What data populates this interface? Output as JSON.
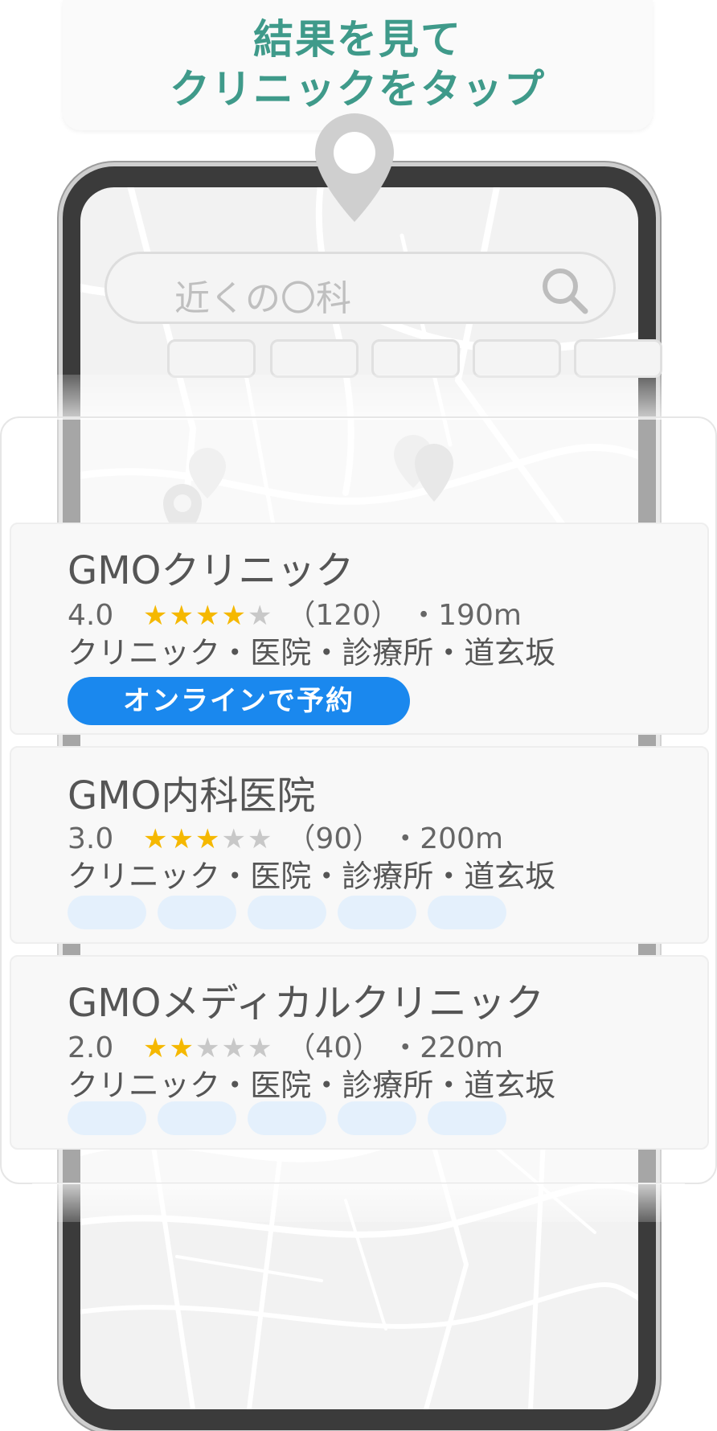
{
  "header": {
    "line1": "結果を見て",
    "line2": "クリニックをタップ"
  },
  "search": {
    "placeholder": "近くの〇科"
  },
  "clinics": [
    {
      "name": "GMOクリニック",
      "rating": "4.0",
      "stars": 4,
      "reviews": "（120）",
      "distance": "・190m",
      "category": "クリニック・医院・診療所・道玄坂",
      "booking_label": "オンラインで予約"
    },
    {
      "name": "GMO内科医院",
      "rating": "3.0",
      "stars": 3,
      "reviews": "（90）",
      "distance": "・200m",
      "category": "クリニック・医院・診療所・道玄坂"
    },
    {
      "name": "GMOメディカルクリニック",
      "rating": "2.0",
      "stars": 2,
      "reviews": "（40）",
      "distance": "・220m",
      "category": "クリニック・医院・診療所・道玄坂"
    }
  ],
  "colors": {
    "header_text": "#3f9a8a",
    "booking_button": "#1a88ee",
    "star_filled": "#f5b800",
    "star_empty": "#c8c8c8",
    "tag_placeholder": "#e4f0fc"
  },
  "icons": {
    "location_pin": "location-pin-icon",
    "search": "search-icon",
    "star": "star-icon"
  }
}
